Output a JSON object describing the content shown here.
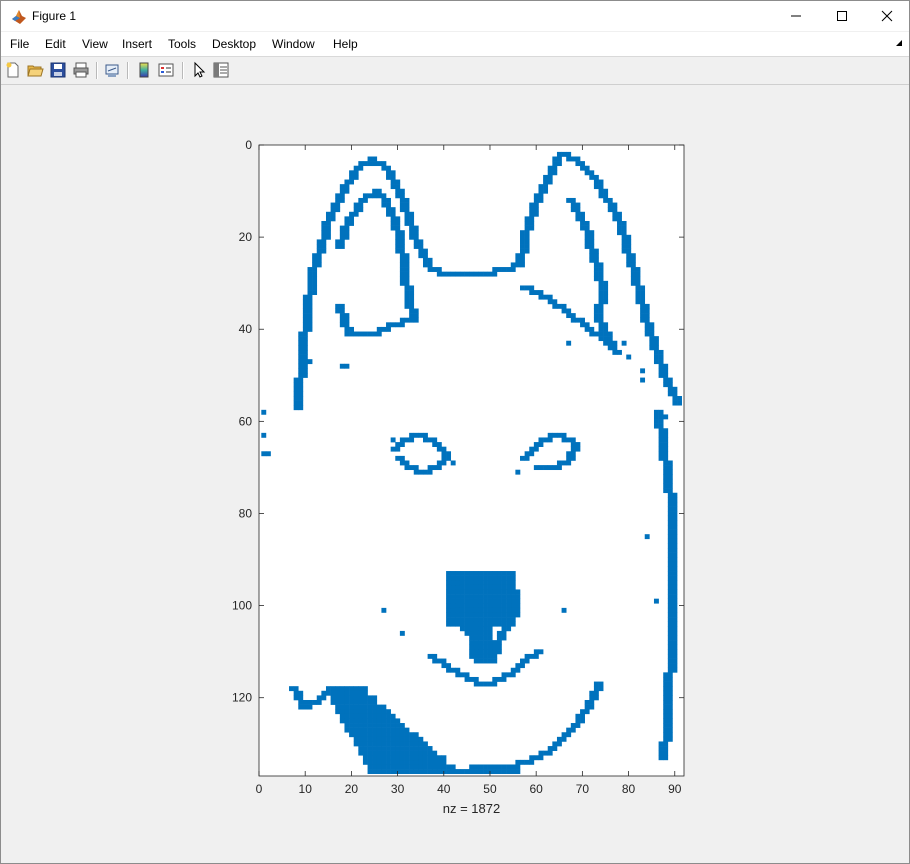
{
  "window": {
    "title": "Figure 1",
    "controls": [
      "minimize",
      "maximize",
      "close"
    ]
  },
  "menu": {
    "items": [
      "File",
      "Edit",
      "View",
      "Insert",
      "Tools",
      "Desktop",
      "Window",
      "Help"
    ]
  },
  "toolbar": {
    "icons": [
      "new-figure-icon",
      "open-file-icon",
      "save-icon",
      "print-icon",
      "link-plot-icon",
      "insert-colorbar-icon",
      "insert-legend-icon",
      "edit-plot-arrow-icon",
      "property-inspector-icon"
    ]
  },
  "chart_data": {
    "type": "scatter",
    "subtype": "spy sparsity pattern",
    "xlabel": "nz = 1872",
    "x_ticks": [
      0,
      10,
      20,
      30,
      40,
      50,
      60,
      70,
      80,
      90
    ],
    "y_ticks": [
      0,
      20,
      40,
      60,
      80,
      100,
      120
    ],
    "xlim": [
      0,
      92
    ],
    "ylim": [
      137,
      0
    ],
    "y_reversed": true,
    "nonzero_count": 1872,
    "marker_color": "#0072BD",
    "marker": "filled square",
    "dense_regions": [
      {
        "name": "left ear outline",
        "points": [
          [
            8,
            57
          ],
          [
            9,
            44
          ],
          [
            10,
            36
          ],
          [
            11,
            28
          ],
          [
            13,
            22
          ],
          [
            15,
            15
          ],
          [
            18,
            9
          ],
          [
            21,
            5
          ],
          [
            24,
            3
          ],
          [
            27,
            5
          ],
          [
            30,
            10
          ],
          [
            32,
            16
          ],
          [
            34,
            22
          ],
          [
            36,
            25
          ]
        ]
      },
      {
        "name": "left ear inner",
        "points": [
          [
            17,
            22
          ],
          [
            19,
            16
          ],
          [
            22,
            12
          ],
          [
            25,
            10
          ],
          [
            28,
            14
          ],
          [
            30,
            20
          ],
          [
            31,
            28
          ],
          [
            32,
            33
          ],
          [
            33,
            38
          ],
          [
            28,
            39
          ],
          [
            24,
            41
          ],
          [
            19,
            41
          ],
          [
            17,
            35
          ]
        ]
      },
      {
        "name": "head top",
        "points": [
          [
            36,
            26
          ],
          [
            40,
            28
          ],
          [
            44,
            28
          ],
          [
            48,
            28
          ],
          [
            52,
            27
          ],
          [
            56,
            26
          ]
        ]
      },
      {
        "name": "right ear outline",
        "points": [
          [
            56,
            26
          ],
          [
            57,
            20
          ],
          [
            59,
            14
          ],
          [
            62,
            7
          ],
          [
            65,
            2
          ],
          [
            68,
            3
          ],
          [
            72,
            7
          ],
          [
            75,
            12
          ],
          [
            78,
            18
          ],
          [
            80,
            25
          ],
          [
            82,
            33
          ],
          [
            84,
            40
          ],
          [
            86,
            46
          ],
          [
            88,
            52
          ],
          [
            90,
            56
          ]
        ]
      },
      {
        "name": "right ear inner",
        "points": [
          [
            57,
            31
          ],
          [
            62,
            33
          ],
          [
            66,
            36
          ],
          [
            70,
            39
          ],
          [
            74,
            42
          ],
          [
            77,
            45
          ],
          [
            73,
            38
          ],
          [
            74,
            31
          ],
          [
            72,
            24
          ],
          [
            70,
            17
          ],
          [
            67,
            12
          ]
        ]
      },
      {
        "name": "left eye",
        "points": [
          [
            29,
            66
          ],
          [
            31,
            64
          ],
          [
            34,
            63
          ],
          [
            37,
            64
          ],
          [
            39,
            66
          ],
          [
            40,
            68
          ],
          [
            38,
            70
          ],
          [
            35,
            71
          ],
          [
            32,
            70
          ],
          [
            30,
            68
          ]
        ]
      },
      {
        "name": "right eye",
        "points": [
          [
            57,
            68
          ],
          [
            59,
            66
          ],
          [
            61,
            64
          ],
          [
            64,
            63
          ],
          [
            67,
            64
          ],
          [
            68,
            66
          ],
          [
            66,
            69
          ],
          [
            63,
            70
          ],
          [
            60,
            70
          ]
        ]
      },
      {
        "name": "nose",
        "points": [
          [
            41,
            97
          ],
          [
            43,
            94
          ],
          [
            46,
            93
          ],
          [
            50,
            93
          ],
          [
            53,
            94
          ],
          [
            55,
            97
          ],
          [
            55,
            101
          ],
          [
            53,
            105
          ],
          [
            51,
            108
          ],
          [
            50,
            112
          ],
          [
            47,
            112
          ],
          [
            46,
            107
          ],
          [
            43,
            104
          ],
          [
            41,
            101
          ]
        ]
      },
      {
        "name": "mouth",
        "points": [
          [
            37,
            111
          ],
          [
            40,
            113
          ],
          [
            44,
            115
          ],
          [
            48,
            117
          ],
          [
            52,
            116
          ],
          [
            55,
            114
          ],
          [
            58,
            111
          ],
          [
            60,
            110
          ]
        ]
      },
      {
        "name": "chin outline",
        "points": [
          [
            7,
            118
          ],
          [
            9,
            122
          ],
          [
            13,
            120
          ],
          [
            16,
            118
          ],
          [
            18,
            121
          ],
          [
            21,
            125
          ],
          [
            24,
            129
          ],
          [
            27,
            132
          ],
          [
            31,
            134
          ],
          [
            36,
            135
          ],
          [
            42,
            136
          ],
          [
            48,
            135
          ],
          [
            53,
            135
          ],
          [
            58,
            134
          ],
          [
            63,
            131
          ],
          [
            67,
            127
          ],
          [
            70,
            123
          ],
          [
            72,
            119
          ],
          [
            73,
            117
          ]
        ]
      },
      {
        "name": "lower left fur",
        "points": [
          [
            15,
            118
          ],
          [
            17,
            121
          ],
          [
            19,
            124
          ],
          [
            21,
            127
          ],
          [
            23,
            130
          ],
          [
            26,
            132
          ],
          [
            29,
            134
          ],
          [
            33,
            135
          ],
          [
            38,
            136
          ],
          [
            44,
            136
          ],
          [
            50,
            136
          ],
          [
            55,
            136
          ]
        ]
      },
      {
        "name": "right edge",
        "points": [
          [
            86,
            58
          ],
          [
            87,
            65
          ],
          [
            88,
            72
          ],
          [
            89,
            80
          ],
          [
            89,
            90
          ],
          [
            89,
            100
          ],
          [
            89,
            110
          ],
          [
            88,
            118
          ],
          [
            88,
            126
          ],
          [
            87,
            133
          ]
        ]
      }
    ],
    "scattered_points": [
      [
        1,
        58
      ],
      [
        1,
        63
      ],
      [
        1,
        67
      ],
      [
        2,
        67
      ],
      [
        11,
        47
      ],
      [
        18,
        48
      ],
      [
        19,
        48
      ],
      [
        29,
        64
      ],
      [
        42,
        69
      ],
      [
        56,
        71
      ],
      [
        83,
        49
      ],
      [
        83,
        51
      ],
      [
        80,
        46
      ],
      [
        79,
        43
      ],
      [
        88,
        59
      ],
      [
        88,
        64
      ],
      [
        84,
        85
      ],
      [
        86,
        99
      ],
      [
        67,
        43
      ],
      [
        27,
        101
      ],
      [
        31,
        106
      ],
      [
        66,
        101
      ]
    ]
  }
}
